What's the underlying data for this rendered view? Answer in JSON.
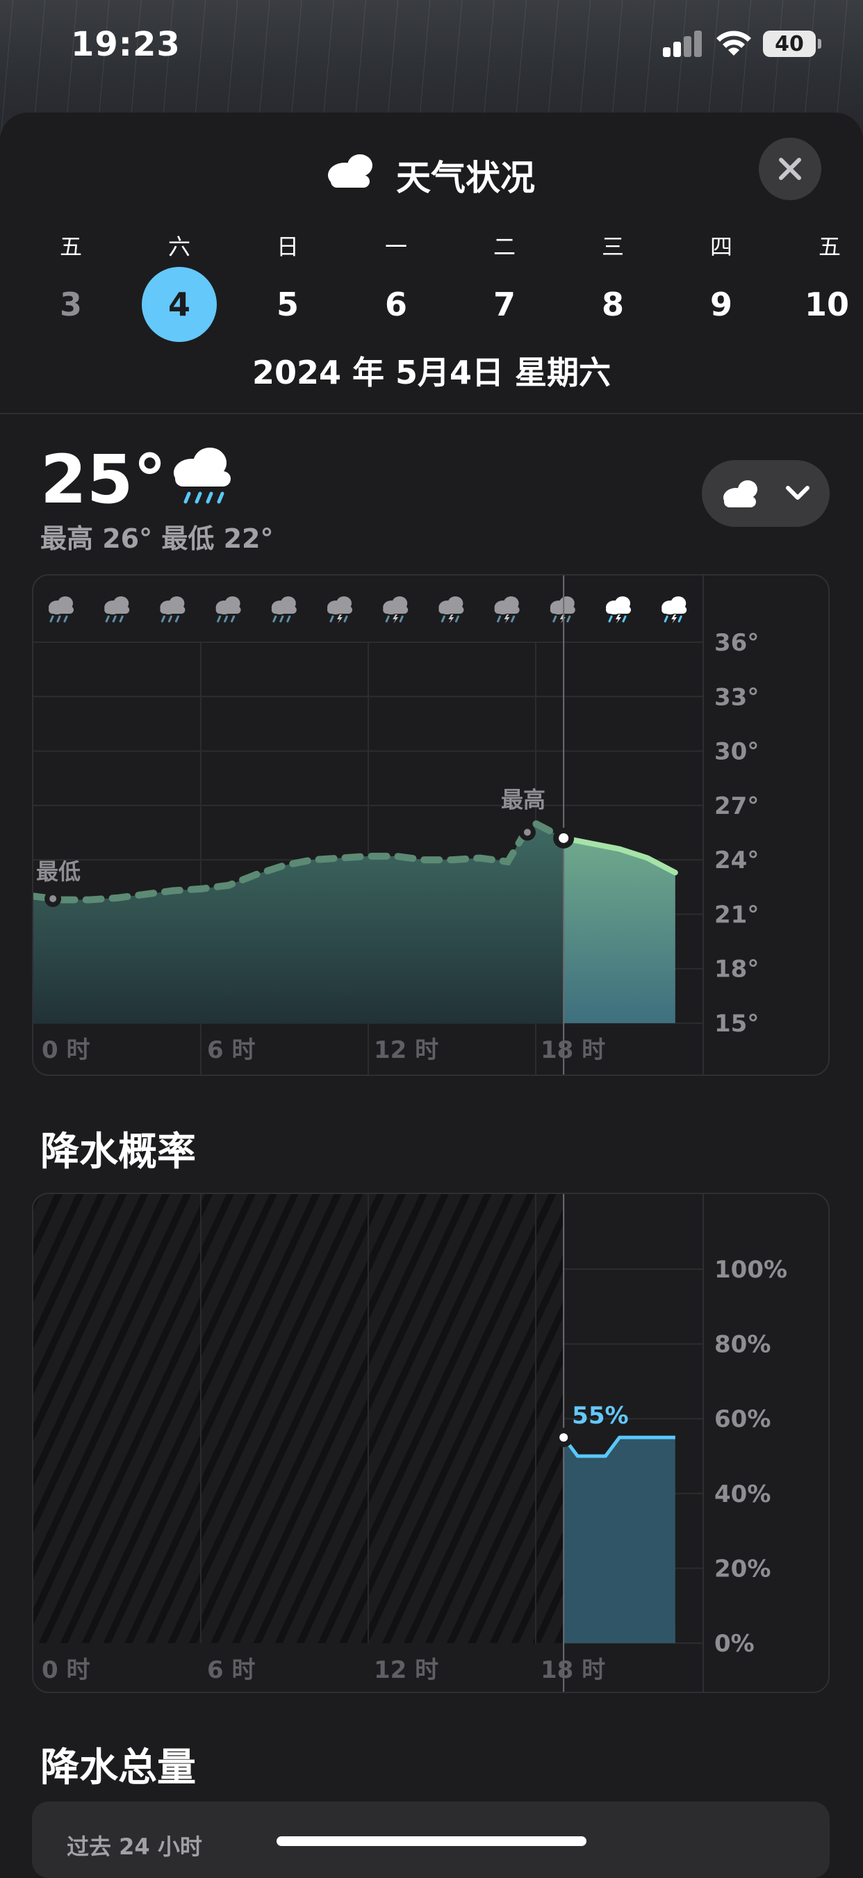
{
  "status_bar": {
    "time": "19:23",
    "battery": "40"
  },
  "header": {
    "title": "天气状况",
    "icon": "cloud-icon",
    "close_icon": "close-icon"
  },
  "week": [
    {
      "weekday": "五",
      "date": "3",
      "state": "past"
    },
    {
      "weekday": "六",
      "date": "4",
      "state": "selected"
    },
    {
      "weekday": "日",
      "date": "5",
      "state": "future"
    },
    {
      "weekday": "一",
      "date": "6",
      "state": "future"
    },
    {
      "weekday": "二",
      "date": "7",
      "state": "future"
    },
    {
      "weekday": "三",
      "date": "8",
      "state": "future"
    },
    {
      "weekday": "四",
      "date": "9",
      "state": "future"
    },
    {
      "weekday": "五",
      "date": "10",
      "state": "future"
    }
  ],
  "date_label": "2024 年 5月4日 星期六",
  "current": {
    "temp": "25°",
    "icon": "cloud-rain-icon",
    "hilo": "最高 26° 最低 22°"
  },
  "view_picker": {
    "icon": "cloud-icon",
    "chevron": "chevron-down-icon"
  },
  "temp_chart_labels": {
    "low": "最低",
    "high": "最高"
  },
  "precip_section": {
    "title": "降水概率",
    "current_label": "55%"
  },
  "totals_section": {
    "title": "降水总量",
    "subtitle": "过去 24 小时"
  },
  "colors": {
    "accent": "#64c8fa",
    "temp_line": "#8fd39a",
    "temp_fill": "#3e6e70",
    "precip_fill": "#2f5566",
    "precip_line": "#5ac8fa"
  },
  "chart_data": [
    {
      "type": "area",
      "x_labels": [
        "0 时",
        "6 时",
        "12 时",
        "18 时"
      ],
      "y_ticks": [
        "36°",
        "33°",
        "30°",
        "27°",
        "24°",
        "21°",
        "18°",
        "15°"
      ],
      "ylim": [
        15,
        36
      ],
      "hour_icons": [
        "cloud-rain-icon",
        "cloud-rain-icon",
        "cloud-rain-icon",
        "cloud-rain-icon",
        "cloud-rain-icon",
        "cloud-bolt-rain-icon",
        "cloud-bolt-rain-icon",
        "cloud-bolt-rain-icon",
        "cloud-bolt-rain-icon",
        "cloud-bolt-rain-icon",
        "cloud-bolt-rain-icon",
        "cloud-bolt-rain-icon"
      ],
      "x": [
        0,
        1,
        2,
        3,
        4,
        5,
        6,
        7,
        8,
        9,
        10,
        11,
        12,
        13,
        14,
        15,
        16,
        17,
        17.5,
        18,
        19,
        20,
        21,
        22,
        23
      ],
      "y": [
        22,
        21.8,
        21.8,
        21.9,
        22.1,
        22.3,
        22.4,
        22.6,
        23.2,
        23.7,
        24.0,
        24.1,
        24.2,
        24.2,
        24.0,
        24.0,
        24.1,
        23.9,
        25.2,
        26.0,
        25.2,
        24.9,
        24.6,
        24.1,
        23.3
      ],
      "current_x": 19,
      "low_x": 0.7,
      "high_x": 17.7
    },
    {
      "type": "line",
      "x_labels": [
        "0 时",
        "6 时",
        "12 时",
        "18 时"
      ],
      "y_ticks": [
        "100%",
        "80%",
        "60%",
        "40%",
        "20%",
        "0%"
      ],
      "ylim": [
        0,
        100
      ],
      "x": [
        19,
        19.5,
        20.5,
        21,
        22,
        23
      ],
      "y": [
        55,
        50,
        50,
        55,
        55,
        55
      ],
      "current_x": 19
    }
  ]
}
